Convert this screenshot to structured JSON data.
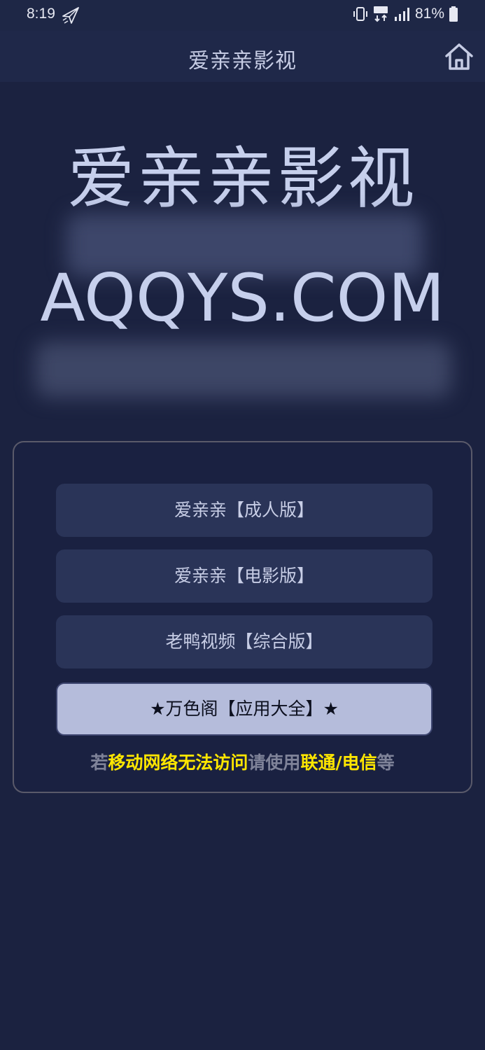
{
  "status_bar": {
    "time": "8:19",
    "battery": "81%",
    "icons": [
      "paper-plane-icon",
      "vibrate-icon",
      "4g-data-icon",
      "4g-signal-icon",
      "battery-icon"
    ]
  },
  "header": {
    "title": "爱亲亲影视",
    "home_icon": "home-icon"
  },
  "hero": {
    "title": "爱亲亲影视",
    "domain": "AQQYS.COM"
  },
  "links": [
    {
      "label": "爱亲亲【成人版】"
    },
    {
      "label": "爱亲亲【电影版】"
    },
    {
      "label": "老鸭视频【综合版】"
    },
    {
      "label": "★万色阁【应用大全】★"
    }
  ],
  "notice": {
    "parts": [
      "若",
      "移动网络无法访问",
      "请使用",
      "联通/电信",
      "等"
    ]
  },
  "colors": {
    "background": "#1b2240",
    "header": "#1f2849",
    "button": "#2a3458",
    "highlight_button": "#b5bcdb",
    "notice_yellow": "#ffe600",
    "notice_grey": "#7f8399"
  }
}
